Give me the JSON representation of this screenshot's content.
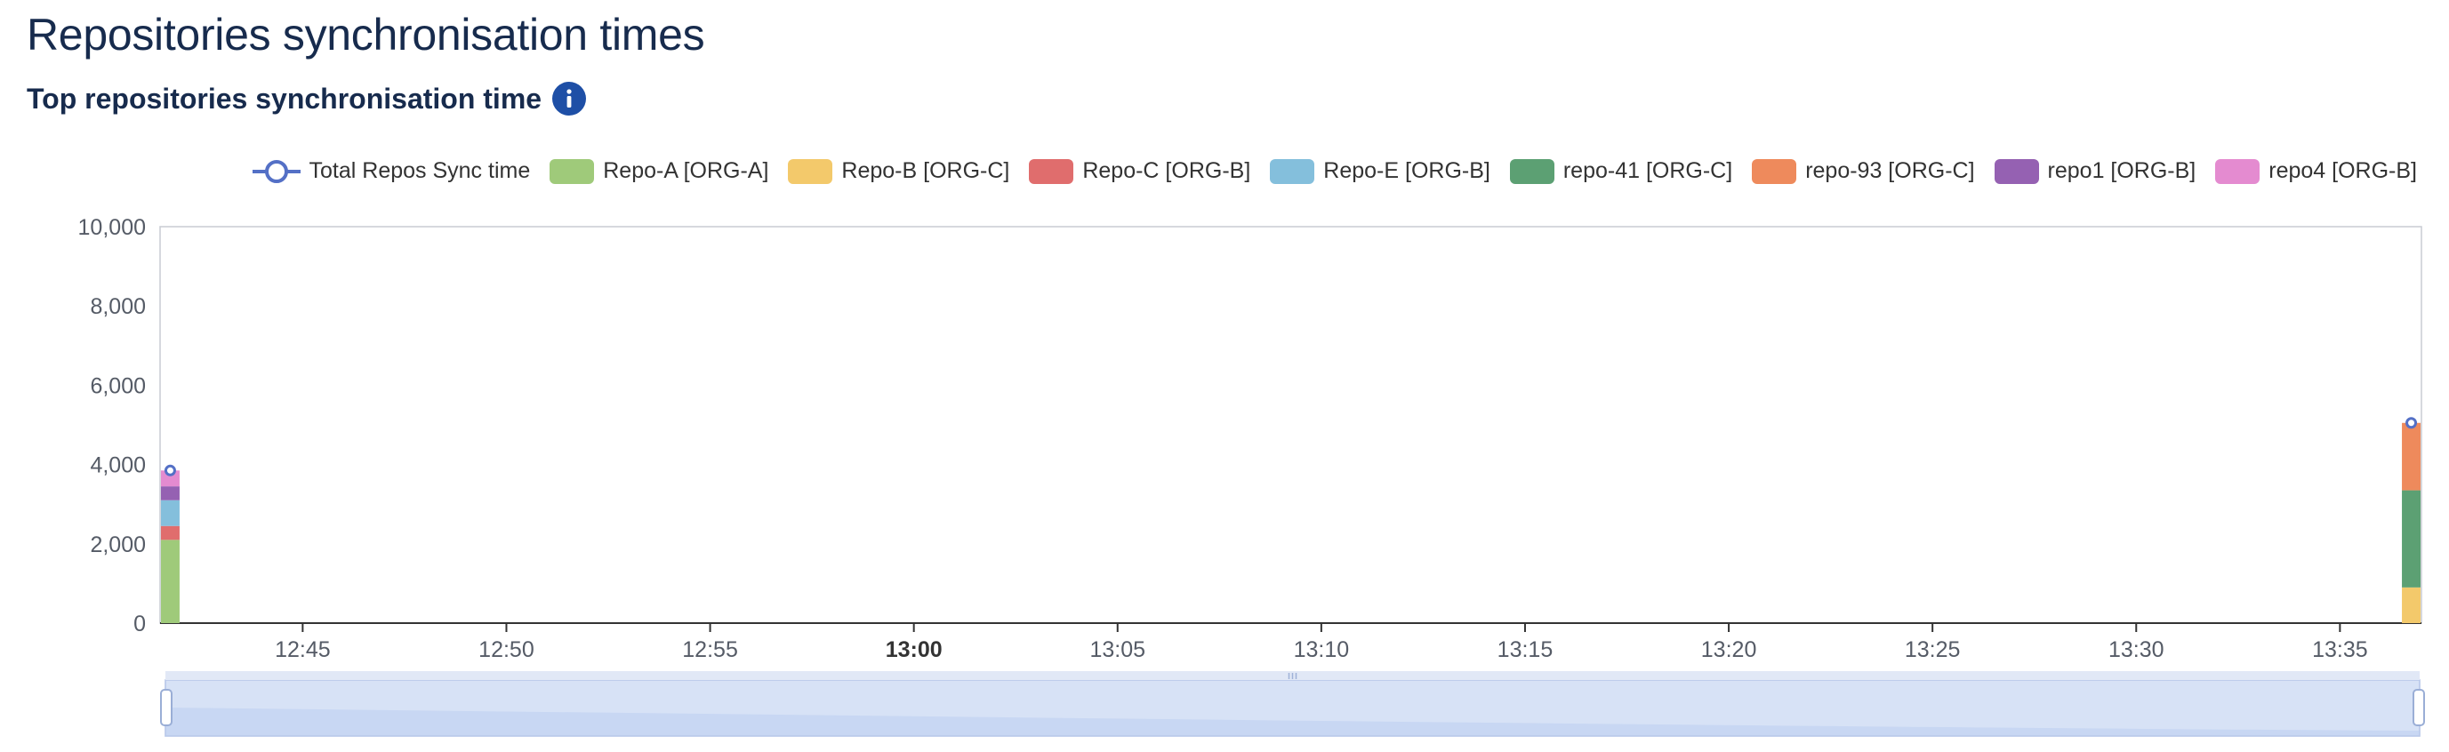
{
  "page": {
    "title": "Repositories synchronisation times"
  },
  "section": {
    "title": "Top repositories synchronisation time",
    "info_icon": "info-icon"
  },
  "legend": {
    "items": [
      {
        "label": "Total Repos Sync time",
        "color": "#5470c6",
        "kind": "line"
      },
      {
        "label": "Repo-A [ORG-A]",
        "color": "#9fca7a",
        "kind": "bar"
      },
      {
        "label": "Repo-B [ORG-C]",
        "color": "#f3c96b",
        "kind": "bar"
      },
      {
        "label": "Repo-C [ORG-B]",
        "color": "#e06d6d",
        "kind": "bar"
      },
      {
        "label": "Repo-E [ORG-B]",
        "color": "#84bfdc",
        "kind": "bar"
      },
      {
        "label": "repo-41 [ORG-C]",
        "color": "#5ca073",
        "kind": "bar"
      },
      {
        "label": "repo-93 [ORG-C]",
        "color": "#ee8a5c",
        "kind": "bar"
      },
      {
        "label": "repo1 [ORG-B]",
        "color": "#9561b2",
        "kind": "bar"
      },
      {
        "label": "repo4 [ORG-B]",
        "color": "#e48bd0",
        "kind": "bar"
      }
    ]
  },
  "chart_data": {
    "type": "bar",
    "stacked": true,
    "title": "Top repositories synchronisation time",
    "xlabel": "",
    "ylabel": "",
    "x_range": [
      "12:41:30",
      "13:37:00"
    ],
    "ylim": [
      0,
      10000
    ],
    "y_ticks": [
      "0",
      "2,000",
      "4,000",
      "6,000",
      "8,000",
      "10,000"
    ],
    "x_ticks": [
      {
        "value": "12:45",
        "label": "12:45",
        "bold": false
      },
      {
        "value": "12:50",
        "label": "12:50",
        "bold": false
      },
      {
        "value": "12:55",
        "label": "12:55",
        "bold": false
      },
      {
        "value": "13:00",
        "label": "13:00",
        "bold": true
      },
      {
        "value": "13:05",
        "label": "13:05",
        "bold": false
      },
      {
        "value": "13:10",
        "label": "13:10",
        "bold": false
      },
      {
        "value": "13:15",
        "label": "13:15",
        "bold": false
      },
      {
        "value": "13:20",
        "label": "13:20",
        "bold": false
      },
      {
        "value": "13:25",
        "label": "13:25",
        "bold": false
      },
      {
        "value": "13:30",
        "label": "13:30",
        "bold": false
      },
      {
        "value": "13:35",
        "label": "13:35",
        "bold": false
      }
    ],
    "x": [
      "12:41:45",
      "13:36:45"
    ],
    "series": [
      {
        "name": "Repo-A [ORG-A]",
        "color": "#9fca7a",
        "values": [
          2100,
          0
        ]
      },
      {
        "name": "Repo-B [ORG-C]",
        "color": "#f3c96b",
        "values": [
          0,
          900
        ]
      },
      {
        "name": "Repo-C [ORG-B]",
        "color": "#e06d6d",
        "values": [
          350,
          0
        ]
      },
      {
        "name": "Repo-E [ORG-B]",
        "color": "#84bfdc",
        "values": [
          650,
          0
        ]
      },
      {
        "name": "repo-41 [ORG-C]",
        "color": "#5ca073",
        "values": [
          0,
          2450
        ]
      },
      {
        "name": "repo-93 [ORG-C]",
        "color": "#ee8a5c",
        "values": [
          0,
          1700
        ]
      },
      {
        "name": "repo1 [ORG-B]",
        "color": "#9561b2",
        "values": [
          350,
          0
        ]
      },
      {
        "name": "repo4 [ORG-B]",
        "color": "#e48bd0",
        "values": [
          400,
          0
        ]
      }
    ],
    "line": {
      "name": "Total Repos Sync time",
      "color": "#5470c6",
      "values": [
        3850,
        5050
      ]
    },
    "grid": false,
    "legend_position": "top-right",
    "data_zoom": {
      "start": 0,
      "end": 100
    }
  }
}
